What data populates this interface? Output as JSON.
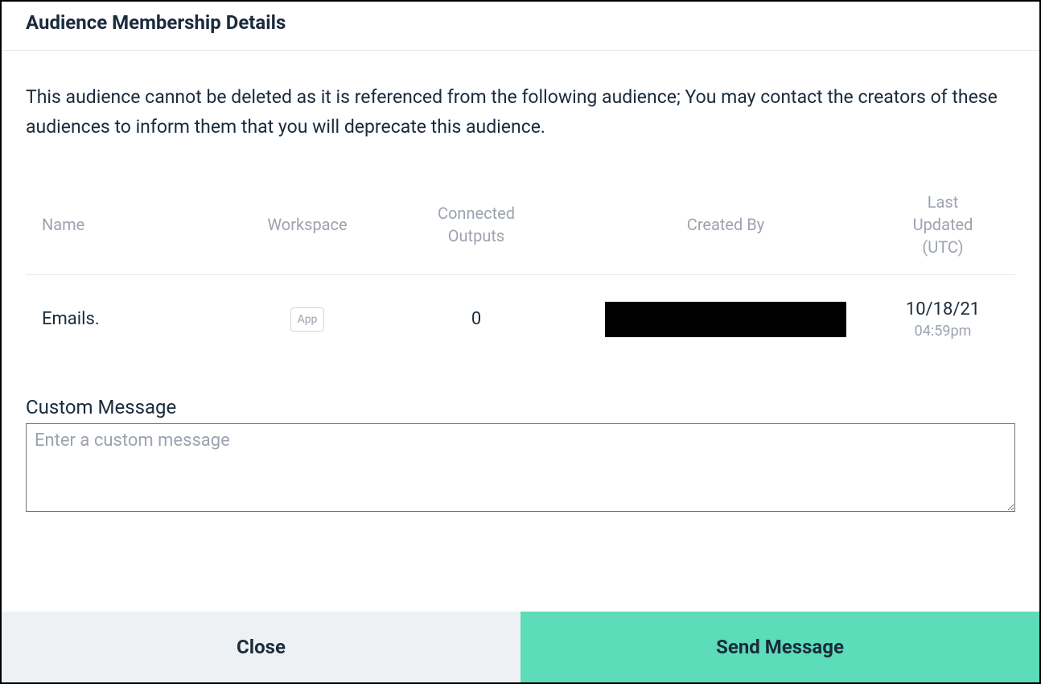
{
  "dialog": {
    "title": "Audience Membership Details",
    "warning": "This audience cannot be deleted as it is referenced from the following audience; You may contact the creators of these audiences to inform them that you will deprecate this audience."
  },
  "table": {
    "headers": {
      "name": "Name",
      "workspace": "Workspace",
      "outputs_line1": "Connected",
      "outputs_line2": "Outputs",
      "created_by": "Created By",
      "updated_line1": "Last",
      "updated_line2": "Updated",
      "updated_line3": "(UTC)"
    },
    "rows": [
      {
        "name": "Emails.",
        "workspace": "App",
        "outputs": "0",
        "created_by": "",
        "updated_date": "10/18/21",
        "updated_time": "04:59pm"
      }
    ]
  },
  "custom_message": {
    "label": "Custom Message",
    "placeholder": "Enter a custom message",
    "value": ""
  },
  "footer": {
    "close": "Close",
    "send": "Send Message"
  },
  "colors": {
    "text_primary": "#1a2b3c",
    "text_muted": "#9ca3af",
    "border": "#e5e7eb",
    "close_bg": "#eef1f3",
    "send_bg": "#5ddcb9"
  }
}
